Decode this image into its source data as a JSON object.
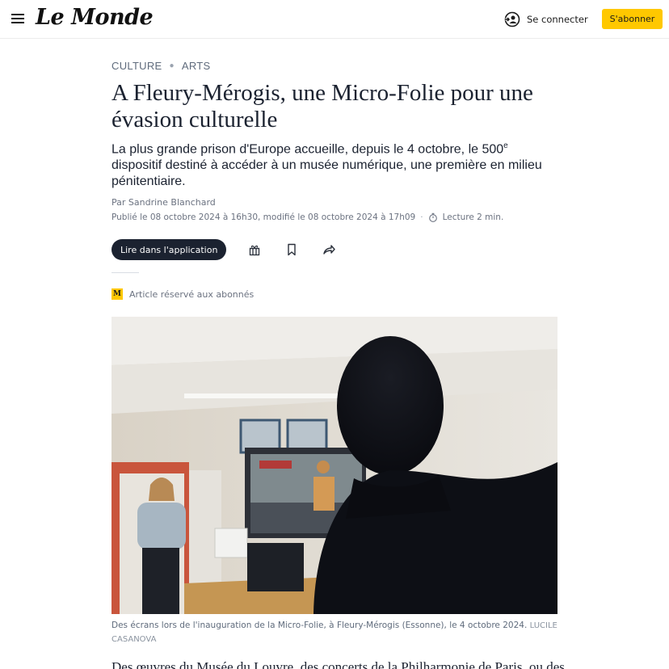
{
  "header": {
    "brand": "Le Monde",
    "login_label": "Se connecter",
    "subscribe_label": "S'abonner",
    "subscribe_color": "#ffc800"
  },
  "article": {
    "breadcrumb": [
      "CULTURE",
      "ARTS"
    ],
    "title": "A Fleury-Mérogis, une Micro-Folie pour une évasion culturelle",
    "lede_part1": "La plus grande prison d'Europe accueille, depuis le 4 octobre, le 500",
    "lede_sup": "e",
    "lede_part2": " dispositif destiné à accéder à un musée numérique, une première en milieu pénitentiaire.",
    "byline_prefix": "Par ",
    "author": "Sandrine Blanchard",
    "dates": "Publié le 08 octobre 2024 à 16h30, modifié le 08 octobre 2024 à 17h09",
    "date_separator": "·",
    "reading_time": "Lecture 2 min.",
    "app_button": "Lire dans l'application",
    "reserved_badge": "M",
    "reserved_label": "Article réservé aux abonnés",
    "caption": "Des écrans lors de l'inauguration de la Micro-Folie, à Fleury-Mérogis (Essonne), le 4 octobre 2024.",
    "credit": "LUCILE CASANOVA",
    "body_start": "Des œuvres du Musée du Louvre, des concerts de la Philharmonie de Paris, ou des"
  },
  "icons": {
    "menu": "hamburger-icon",
    "login": "user-icon",
    "timer": "stopwatch-icon",
    "gift": "gift-icon",
    "bookmark": "bookmark-icon",
    "share": "share-icon"
  },
  "colors": {
    "accent": "#ffc800",
    "dark_button": "#1b2230"
  }
}
